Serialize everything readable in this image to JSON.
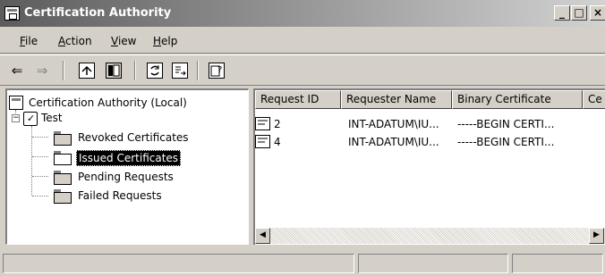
{
  "window": {
    "title": "Certification Authority",
    "controls": {
      "minimize": "_",
      "maximize": "□",
      "close": "×"
    }
  },
  "menu": [
    {
      "label": "File",
      "accel": "F",
      "rest": "ile"
    },
    {
      "label": "Action",
      "accel": "A",
      "rest": "ction"
    },
    {
      "label": "View",
      "accel": "V",
      "rest": "iew"
    },
    {
      "label": "Help",
      "accel": "H",
      "rest": "elp"
    }
  ],
  "toolbar": {
    "icons": [
      "back-arrow-icon",
      "forward-arrow-icon",
      "up-folder-icon",
      "show-hide-tree-icon",
      "refresh-icon",
      "export-list-icon",
      "help-icon"
    ],
    "back": "⇐",
    "forward": "⇒"
  },
  "tree": {
    "root": "Certification Authority (Local)",
    "ca": "Test",
    "expander": "−",
    "children": [
      "Revoked Certificates",
      "Issued Certificates",
      "Pending Requests",
      "Failed Requests"
    ],
    "selected": "Issued Certificates"
  },
  "list": {
    "columns": [
      "Request ID",
      "Requester Name",
      "Binary Certificate",
      "Ce"
    ],
    "rows": [
      [
        "2",
        "INT-ADATUM\\IU...",
        "-----BEGIN CERTI..."
      ],
      [
        "4",
        "INT-ADATUM\\IU...",
        "-----BEGIN CERTI..."
      ]
    ]
  },
  "scrollbar": {
    "left_arrow": "◀",
    "right_arrow": "▶"
  },
  "colors": {
    "title_gradient_start": "#5c5c5c",
    "title_gradient_end": "#d2d2d2",
    "face": "#d4d0c8",
    "selection": "#000000"
  }
}
